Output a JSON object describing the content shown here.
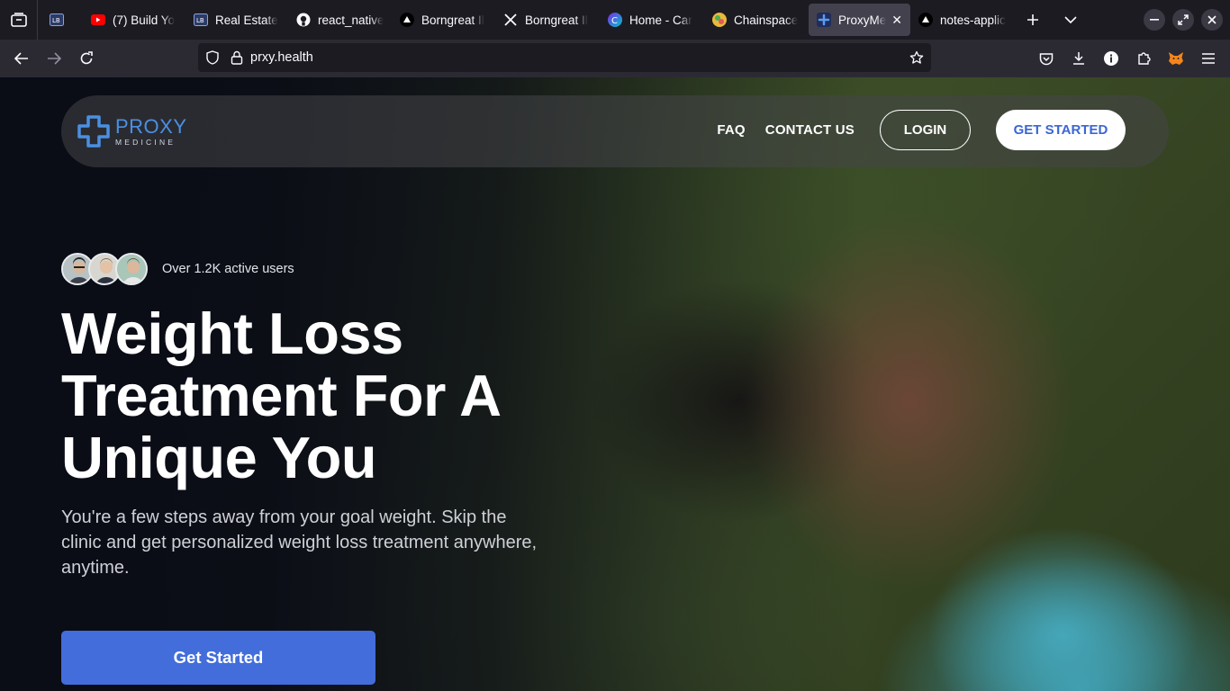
{
  "browser": {
    "tabs": [
      {
        "label": "",
        "icon": "app-icon"
      },
      {
        "label": "(7) Build Yo",
        "icon": "youtube-icon"
      },
      {
        "label": "Real Estate",
        "icon": "app-icon"
      },
      {
        "label": "react_native",
        "icon": "github-icon"
      },
      {
        "label": "Borngreat Il",
        "icon": "triangle-icon"
      },
      {
        "label": "Borngreat Il",
        "icon": "x-logo-icon"
      },
      {
        "label": "Home - Car",
        "icon": "canva-icon"
      },
      {
        "label": "Chainspace",
        "icon": "chainspace-icon"
      },
      {
        "label": "ProxyMed",
        "icon": "proxy-icon",
        "active": true
      },
      {
        "label": "notes-applic",
        "icon": "triangle-icon"
      }
    ],
    "url": "prxy.health"
  },
  "site": {
    "logo": {
      "name": "PROXY",
      "sub": "MEDICINE"
    },
    "nav": {
      "faq": "FAQ",
      "contact": "CONTACT US",
      "login": "LOGIN",
      "get_started": "GET STARTED"
    },
    "hero": {
      "users_text": "Over 1.2K active users",
      "title": "Weight Loss Treatment For A Unique You",
      "subtitle": "You're a few steps away from your goal weight. Skip the clinic and get personalized weight loss treatment anywhere, anytime.",
      "cta": "Get Started"
    }
  },
  "colors": {
    "brand": "#4a90e2",
    "cta": "#426ddb",
    "browser_bg": "#1c1b22",
    "toolbar_bg": "#2b2a33"
  }
}
